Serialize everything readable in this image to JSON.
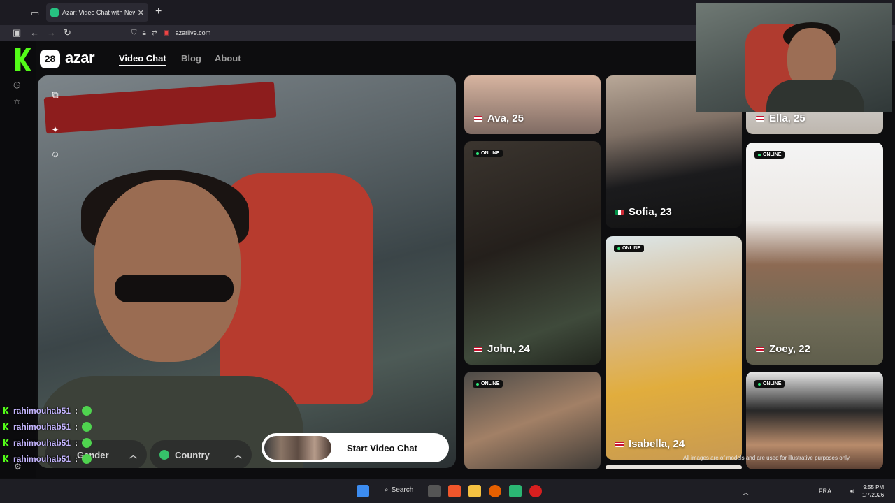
{
  "browser": {
    "tab_title": "Azar: Video Chat with New People",
    "url": "azarlive.com"
  },
  "site": {
    "logo_badge": "28",
    "logo_text": "azar",
    "nav": [
      "Video Chat",
      "Blog",
      "About"
    ]
  },
  "controls": {
    "gender_label": "Gender",
    "country_label": "Country",
    "start_label": "Start Video Chat"
  },
  "cards": [
    {
      "name": "Ava, 25",
      "flag": "us",
      "online": false
    },
    {
      "name": "John, 24",
      "flag": "us",
      "online": true
    },
    {
      "name": "",
      "flag": "",
      "online": true
    },
    {
      "name": "Sofia, 23",
      "flag": "it",
      "online": false
    },
    {
      "name": "Isabella, 24",
      "flag": "us",
      "online": true
    },
    {
      "name": "Ella, 25",
      "flag": "us",
      "online": false
    },
    {
      "name": "Zoey, 22",
      "flag": "us",
      "online": true
    },
    {
      "name": "",
      "flag": "",
      "online": true
    }
  ],
  "online_badge": "ONLINE",
  "disclaimer": "All images are of models and are used for illustrative purposes only.",
  "chat": [
    {
      "user": "rahimouhab51"
    },
    {
      "user": "rahimouhab51"
    },
    {
      "user": "rahimouhab51"
    },
    {
      "user": "rahimouhab51"
    }
  ],
  "taskbar": {
    "search_label": "Search",
    "lang": "FRA",
    "time": "9:55 PM",
    "date": "1/7/2026"
  }
}
